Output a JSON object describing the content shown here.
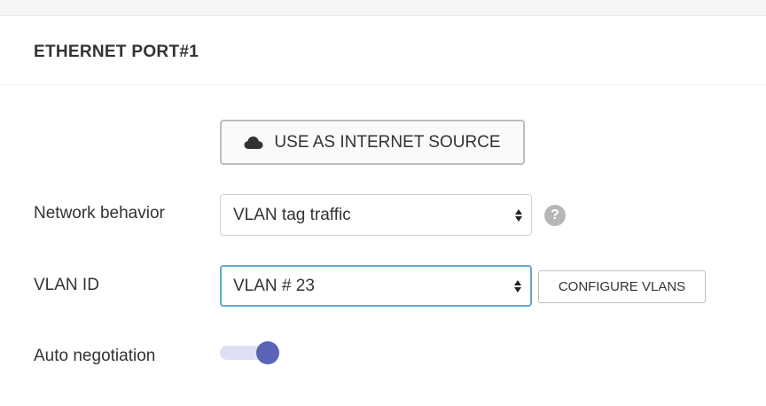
{
  "section": {
    "title": "ETHERNET PORT#1"
  },
  "internet_source_button": {
    "label": "USE AS INTERNET SOURCE",
    "icon": "cloud-icon"
  },
  "network_behavior": {
    "label": "Network behavior",
    "value": "VLAN tag traffic",
    "help_icon": "?"
  },
  "vlan_id": {
    "label": "VLAN ID",
    "value": "VLAN # 23",
    "configure_label": "CONFIGURE VLANS"
  },
  "auto_negotiation": {
    "label": "Auto negotiation",
    "enabled": true
  },
  "colors": {
    "accent": "#5b64b4",
    "focus_border": "#64a8c8",
    "help_bg": "#b7b7b7"
  }
}
